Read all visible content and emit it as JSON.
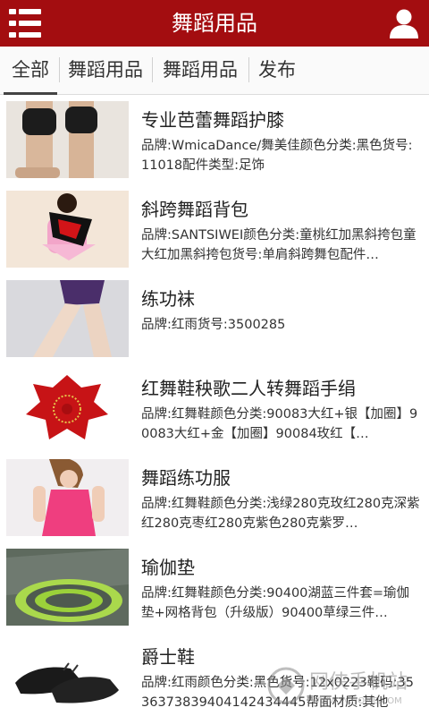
{
  "header": {
    "title": "舞蹈用品",
    "menu_icon": "menu-icon",
    "user_icon": "user-icon",
    "bar_color": "#a30d10"
  },
  "tabs": [
    {
      "label": "全部",
      "active": true
    },
    {
      "label": "舞蹈用品",
      "active": false
    },
    {
      "label": "舞蹈用品",
      "active": false
    },
    {
      "label": "发布",
      "active": false
    }
  ],
  "products": [
    {
      "title": "专业芭蕾舞蹈护膝",
      "desc": "品牌:WmicaDance/舞美佳颜色分类:黑色货号:11018配件类型:足饰",
      "image": "knee-pads-photo"
    },
    {
      "title": "斜跨舞蹈背包",
      "desc": "品牌:SANTSIWEI颜色分类:童桃红加黑斜挎包童大红加黑斜挎包货号:单肩斜跨舞包配件…",
      "image": "dance-backpack-photo"
    },
    {
      "title": "练功袜",
      "desc": "品牌:红雨货号:3500285",
      "image": "tights-photo"
    },
    {
      "title": "红舞鞋秧歌二人转舞蹈手绢",
      "desc": "品牌:红舞鞋颜色分类:90083大红+银【加圈】90083大红+金【加圈】90084玫红【…",
      "image": "dance-handkerchief-photo"
    },
    {
      "title": "舞蹈练功服",
      "desc": "品牌:红舞鞋颜色分类:浅绿280克玫红280克深紫红280克枣红280克紫色280克紫罗…",
      "image": "practice-wear-photo"
    },
    {
      "title": "瑜伽垫",
      "desc": "品牌:红舞鞋颜色分类:90400湖蓝三件套=瑜伽垫+网格背包（升级版）90400草绿三件…",
      "image": "yoga-mat-photo"
    },
    {
      "title": "爵士鞋",
      "desc": "品牌:红雨颜色分类:黑色货号:12x0223鞋码:3536373839404142434445帮面材质:其他",
      "image": "jazz-shoes-photo"
    }
  ],
  "watermark": {
    "text": "网侠手机站",
    "url": "WWW.PCHOME.COM"
  }
}
